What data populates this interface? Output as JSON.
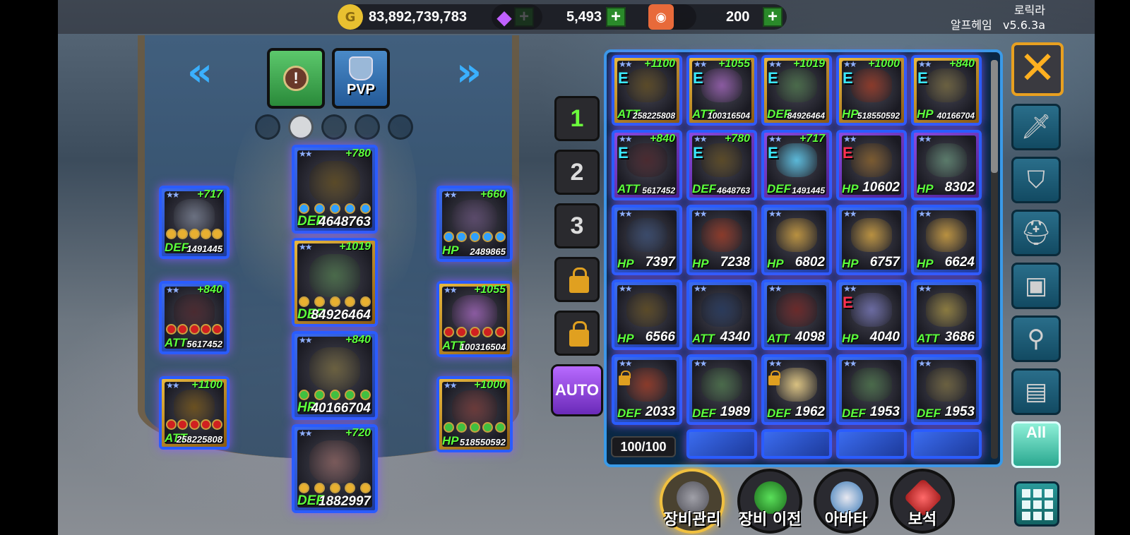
{
  "topbar": {
    "gold": "83,892,739,783",
    "gems": "5,493",
    "tickets": "200",
    "username": "로릭라",
    "server": "알프헤임",
    "version": "v5.6.3a"
  },
  "tabs": {
    "pvp_label": "PVP"
  },
  "presets": {
    "slot1": "1",
    "slot2": "2",
    "slot3": "3",
    "auto_label": "AUTO"
  },
  "equipped": [
    {
      "grade": "",
      "bonus": "+717",
      "stat": "DEF",
      "value": "1491445"
    },
    {
      "grade": "",
      "bonus": "+840",
      "stat": "ATT",
      "value": "5617452"
    },
    {
      "grade": "",
      "bonus": "+1100",
      "stat": "ATT",
      "value": "258225808"
    },
    {
      "grade": "",
      "bonus": "+780",
      "stat": "DEF",
      "value": "4648763"
    },
    {
      "grade": "",
      "bonus": "+1019",
      "stat": "DEF",
      "value": "84926464"
    },
    {
      "grade": "",
      "bonus": "+840",
      "stat": "HP",
      "value": "40166704"
    },
    {
      "grade": "",
      "bonus": "+720",
      "stat": "DEF",
      "value": "1882997"
    },
    {
      "grade": "",
      "bonus": "+660",
      "stat": "HP",
      "value": "2489865"
    },
    {
      "grade": "",
      "bonus": "+1055",
      "stat": "ATT",
      "value": "100316504"
    },
    {
      "grade": "",
      "bonus": "+1000",
      "stat": "HP",
      "value": "518550592"
    }
  ],
  "inventory": {
    "count": "100/100",
    "items": [
      {
        "grade": "E",
        "bonus": "+1100",
        "stat": "ATT",
        "value": "258225808"
      },
      {
        "grade": "E",
        "bonus": "+1055",
        "stat": "ATT",
        "value": "100316504"
      },
      {
        "grade": "E",
        "bonus": "+1019",
        "stat": "DEF",
        "value": "84926464"
      },
      {
        "grade": "E",
        "bonus": "+1000",
        "stat": "HP",
        "value": "518550592"
      },
      {
        "grade": "E",
        "bonus": "+840",
        "stat": "HP",
        "value": "40166704"
      },
      {
        "grade": "E",
        "bonus": "+840",
        "stat": "ATT",
        "value": "5617452"
      },
      {
        "grade": "E",
        "bonus": "+780",
        "stat": "DEF",
        "value": "4648763"
      },
      {
        "grade": "E",
        "bonus": "+717",
        "stat": "DEF",
        "value": "1491445"
      },
      {
        "grade": "E",
        "bonus": "",
        "stat": "HP",
        "value": "10602"
      },
      {
        "grade": "",
        "bonus": "",
        "stat": "HP",
        "value": "8302"
      },
      {
        "grade": "",
        "bonus": "",
        "stat": "HP",
        "value": "7397"
      },
      {
        "grade": "",
        "bonus": "",
        "stat": "HP",
        "value": "7238"
      },
      {
        "grade": "",
        "bonus": "",
        "stat": "HP",
        "value": "6802"
      },
      {
        "grade": "",
        "bonus": "",
        "stat": "HP",
        "value": "6757"
      },
      {
        "grade": "",
        "bonus": "",
        "stat": "HP",
        "value": "6624"
      },
      {
        "grade": "",
        "bonus": "",
        "stat": "HP",
        "value": "6566"
      },
      {
        "grade": "",
        "bonus": "",
        "stat": "ATT",
        "value": "4340"
      },
      {
        "grade": "",
        "bonus": "",
        "stat": "ATT",
        "value": "4098"
      },
      {
        "grade": "E",
        "bonus": "",
        "stat": "HP",
        "value": "4040"
      },
      {
        "grade": "",
        "bonus": "",
        "stat": "ATT",
        "value": "3686"
      },
      {
        "grade": "",
        "bonus": "",
        "stat": "DEF",
        "value": "2033"
      },
      {
        "grade": "",
        "bonus": "",
        "stat": "DEF",
        "value": "1989"
      },
      {
        "grade": "",
        "bonus": "",
        "stat": "DEF",
        "value": "1962"
      },
      {
        "grade": "",
        "bonus": "",
        "stat": "DEF",
        "value": "1953"
      },
      {
        "grade": "",
        "bonus": "",
        "stat": "DEF",
        "value": "1953"
      }
    ]
  },
  "filters": {
    "all_label": "All"
  },
  "actions": {
    "manage": "장비관리",
    "transfer": "장비 이전",
    "avatar": "아바타",
    "gem": "보석"
  }
}
